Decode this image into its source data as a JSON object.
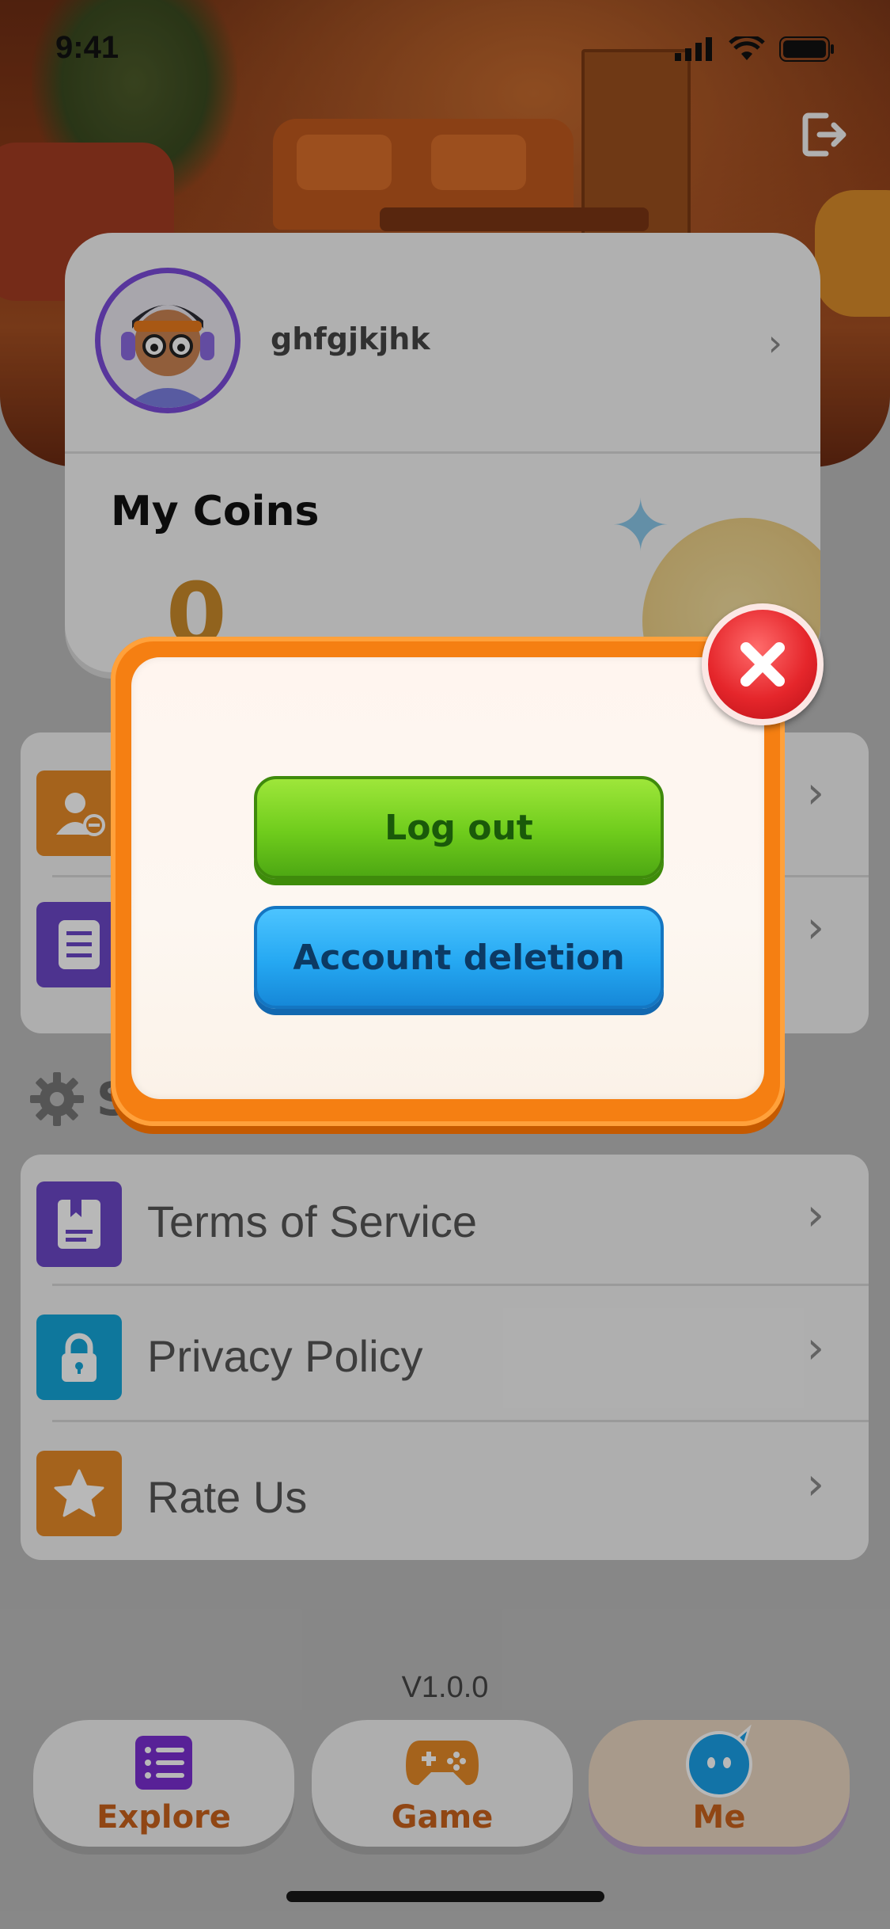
{
  "status_bar": {
    "time": "9:41"
  },
  "profile": {
    "username": "ghfgjkjhk"
  },
  "coins": {
    "title": "My Coins",
    "value": "0"
  },
  "settings": {
    "heading": "S"
  },
  "menu": [
    {
      "label": "Terms of Service",
      "icon": "document-icon",
      "color": "#6b47c7"
    },
    {
      "label": "Privacy Policy",
      "icon": "lock-icon",
      "color": "#14a6d8"
    },
    {
      "label": "Rate Us",
      "icon": "star-icon",
      "color": "#e58a28"
    }
  ],
  "account_section": [
    {
      "icon": "user-remove-icon",
      "color": "#e58a28"
    },
    {
      "icon": "list-icon",
      "color": "#6b47c7"
    }
  ],
  "version": "V1.0.0",
  "tabs": [
    {
      "label": "Explore",
      "icon": "list-icon",
      "active": false
    },
    {
      "label": "Game",
      "icon": "gamepad-icon",
      "active": false
    },
    {
      "label": "Me",
      "icon": "mascot-icon",
      "active": true
    }
  ],
  "modal": {
    "logout_label": "Log out",
    "delete_label": "Account deletion"
  }
}
